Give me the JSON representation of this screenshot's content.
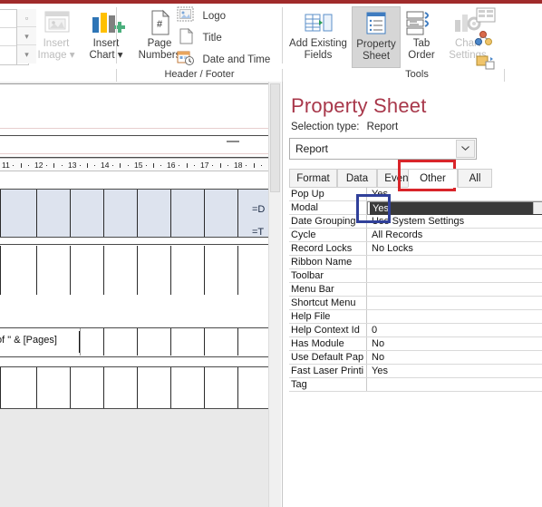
{
  "ribbon": {
    "groups": [
      {
        "label": "Header / Footer"
      },
      {
        "label": "Tools"
      }
    ],
    "buttons": [
      {
        "name": "insert-image",
        "label": "Insert\nImage ▾",
        "state": "disabled"
      },
      {
        "name": "insert-chart",
        "label": "Insert\nChart ▾",
        "state": "enabled"
      },
      {
        "name": "page-numbers",
        "label": "Page\nNumbers",
        "state": "enabled"
      },
      {
        "name": "logo",
        "label": "Logo",
        "state": "enabled"
      },
      {
        "name": "title",
        "label": "Title",
        "state": "enabled"
      },
      {
        "name": "date-and-time",
        "label": "Date and Time",
        "state": "enabled"
      },
      {
        "name": "add-existing-fields",
        "label": "Add Existing\nFields",
        "state": "enabled"
      },
      {
        "name": "property-sheet",
        "label": "Property\nSheet",
        "state": "active"
      },
      {
        "name": "tab-order",
        "label": "Tab\nOrder",
        "state": "enabled"
      },
      {
        "name": "chart-settings",
        "label": "Chart\nSettings",
        "state": "disabled"
      }
    ]
  },
  "design": {
    "ruler_labels": [
      "11",
      "12",
      "13",
      "14",
      "15",
      "16",
      "17",
      "18"
    ],
    "controls": [
      {
        "name": "date-expression",
        "text": "=D"
      },
      {
        "name": "time-expression",
        "text": "=T"
      },
      {
        "name": "page-expression",
        "text": "of \" & [Pages]"
      }
    ]
  },
  "property_sheet": {
    "title": "Property Sheet",
    "selection_label": "Selection type:",
    "selection_value": "Report",
    "object_combo": {
      "value": "Report"
    },
    "tabs": [
      {
        "label": "Format",
        "selected": false
      },
      {
        "label": "Data",
        "selected": false
      },
      {
        "label": "Event",
        "selected": false
      },
      {
        "label": "Other",
        "selected": true
      },
      {
        "label": "All",
        "selected": false
      }
    ],
    "properties": [
      {
        "name": "Pop Up",
        "value": "Yes",
        "state": "normal"
      },
      {
        "name": "Modal",
        "value": "Yes",
        "state": "editing-selected"
      },
      {
        "name": "Date Grouping",
        "value": "Use System Settings",
        "state": "normal"
      },
      {
        "name": "Cycle",
        "value": "All Records",
        "state": "normal"
      },
      {
        "name": "Record Locks",
        "value": "No Locks",
        "state": "normal"
      },
      {
        "name": "Ribbon Name",
        "value": "",
        "state": "normal"
      },
      {
        "name": "Toolbar",
        "value": "",
        "state": "normal"
      },
      {
        "name": "Menu Bar",
        "value": "",
        "state": "normal"
      },
      {
        "name": "Shortcut Menu",
        "value": "",
        "state": "normal"
      },
      {
        "name": "Help File",
        "value": "",
        "state": "normal"
      },
      {
        "name": "Help Context Id",
        "value": "0",
        "state": "normal"
      },
      {
        "name": "Has Module",
        "value": "No",
        "state": "normal"
      },
      {
        "name": "Use Default Pap",
        "value": "No",
        "state": "normal"
      },
      {
        "name": "Fast Laser Printi",
        "value": "Yes",
        "state": "normal"
      },
      {
        "name": "Tag",
        "value": "",
        "state": "normal"
      }
    ]
  },
  "annotations": {
    "red_box_target": "Other",
    "red_color": "#d9252a",
    "blue_box_target": "Modal value",
    "blue_color": "#30409a"
  }
}
